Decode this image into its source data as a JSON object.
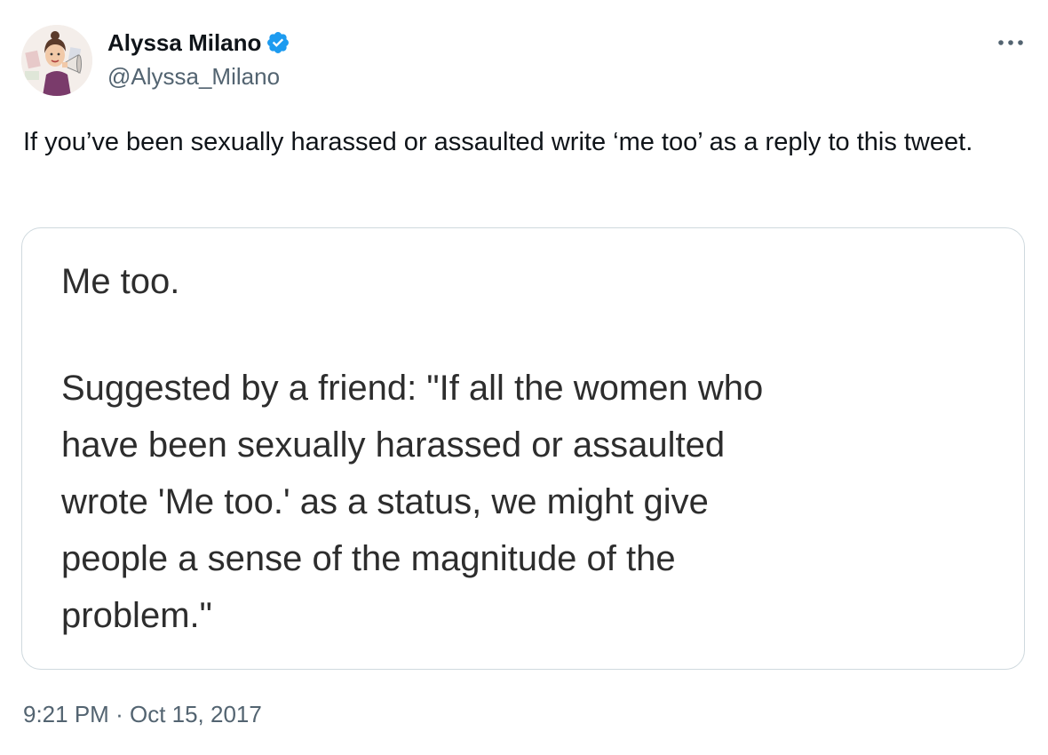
{
  "author": {
    "display_name": "Alyssa Milano",
    "handle": "@Alyssa_Milano",
    "verified_icon": "verified-badge-icon",
    "avatar_icon": "avatar-caricature-megaphone"
  },
  "more_icon": "more-horizontal-icon",
  "tweet": {
    "text": "If you’ve been sexually harassed or assaulted write ‘me too’ as a reply to this tweet."
  },
  "media": {
    "line1": "Me too.",
    "lines": [
      "Suggested by a friend: \"If all the women who",
      "have been sexually harassed or assaulted",
      "wrote 'Me too.' as a status, we might give",
      "people a sense of the magnitude of the",
      "problem.\""
    ]
  },
  "meta": {
    "time": "9:21 PM",
    "separator": "·",
    "date": "Oct 15, 2017"
  },
  "colors": {
    "text": "#0f1419",
    "secondary": "#536471",
    "verified": "#1d9bf0",
    "border": "#cfd9de"
  }
}
